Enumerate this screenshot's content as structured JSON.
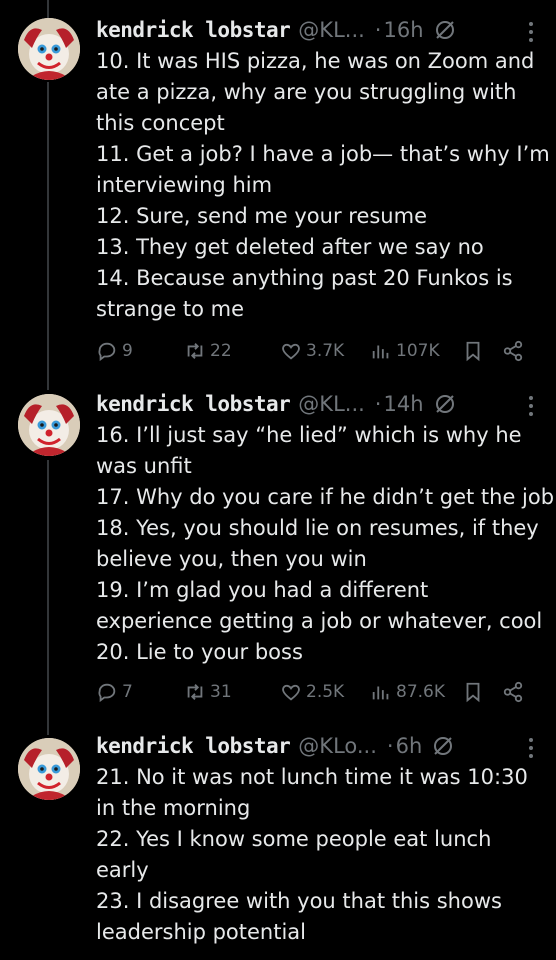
{
  "colors": {
    "background": "#000000",
    "text": "#e7e9ea",
    "muted": "#71767b",
    "thread_line": "#333639"
  },
  "tweets": [
    {
      "name": "kendrick lobstar",
      "handle": "@KL...",
      "time": "16h",
      "separator": "·",
      "lines": [
        "10. It was HIS pizza, he was on Zoom and",
        "ate a pizza, why are you struggling with",
        "this concept",
        "11. Get a job? I have a job— that’s why I’m",
        "interviewing him",
        "12. Sure, send me your resume",
        "13. They get deleted after we say no",
        "14. Because anything past 20 Funkos is",
        "strange to me"
      ],
      "replies": "9",
      "retweets": "22",
      "likes": "3.7K",
      "views": "107K"
    },
    {
      "name": "kendrick lobstar",
      "handle": "@KL...",
      "time": "14h",
      "separator": "·",
      "lines": [
        "16. I’ll just say “he lied” which is why he",
        "was unfit",
        "17. Why do you care if he didn’t get the job",
        "18. Yes, you should lie on resumes, if they",
        "believe you, then you win",
        "19. I’m glad you had a different",
        "experience getting a job or whatever, cool",
        "20. Lie to your boss"
      ],
      "replies": "7",
      "retweets": "31",
      "likes": "2.5K",
      "views": "87.6K"
    },
    {
      "name": "kendrick lobstar",
      "handle": "@KLo...",
      "time": "6h",
      "separator": "·",
      "lines": [
        "21. No it was not lunch time it was 10:30",
        "in the morning",
        "22. Yes I know some people eat lunch",
        "early",
        "23. I disagree with you that this shows",
        "leadership potential"
      ]
    }
  ],
  "icons": [
    "avatar",
    "grok-icon",
    "more-icon",
    "reply-icon",
    "retweet-icon",
    "like-icon",
    "views-icon",
    "bookmark-icon",
    "share-icon"
  ]
}
